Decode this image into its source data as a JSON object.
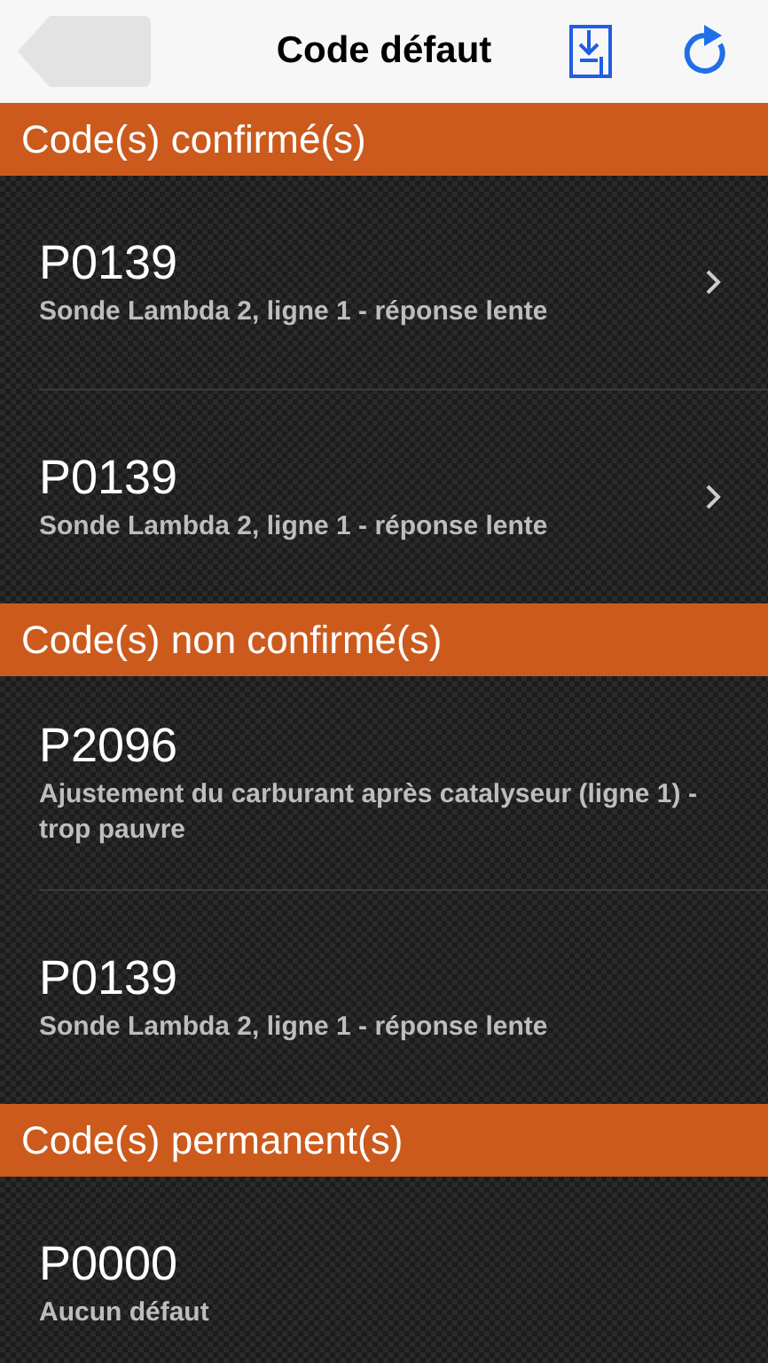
{
  "nav": {
    "title": "Code défaut"
  },
  "sections": [
    {
      "title": "Code(s) confirmé(s)",
      "rows": [
        {
          "code": "P0139",
          "description": "Sonde Lambda 2, ligne 1 - réponse lente",
          "chevron": true
        },
        {
          "code": "P0139",
          "description": "Sonde Lambda 2, ligne 1 - réponse lente",
          "chevron": true
        }
      ]
    },
    {
      "title": "Code(s) non confirmé(s)",
      "rows": [
        {
          "code": "P2096",
          "description": "Ajustement du carburant après catalyseur (ligne 1) - trop pauvre",
          "chevron": false
        },
        {
          "code": "P0139",
          "description": "Sonde Lambda 2, ligne 1 - réponse lente",
          "chevron": false
        }
      ]
    },
    {
      "title": "Code(s) permanent(s)",
      "rows": [
        {
          "code": "P0000",
          "description": "Aucun défaut",
          "chevron": false
        }
      ]
    }
  ]
}
